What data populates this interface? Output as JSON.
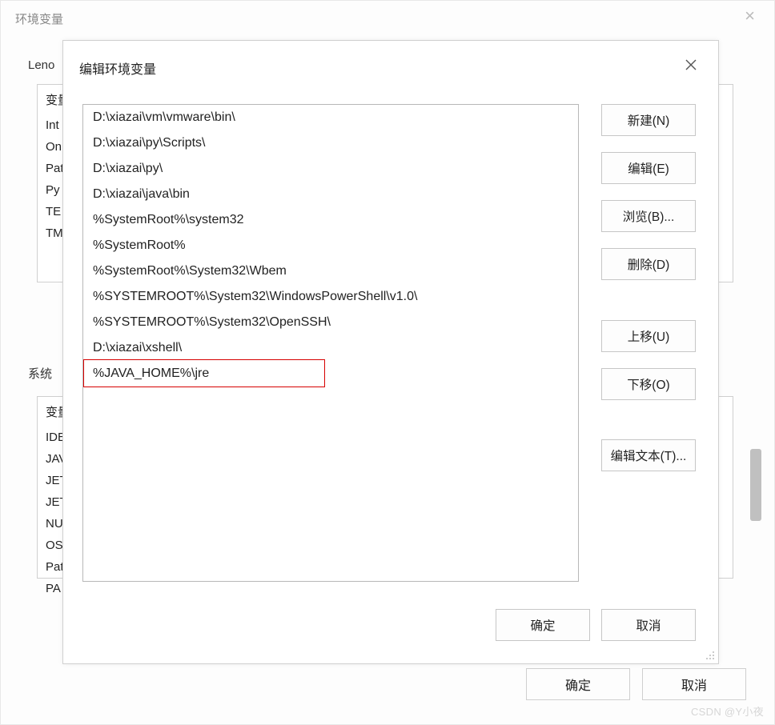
{
  "parent": {
    "title": "环境变量",
    "user_label_prefix": "Leno",
    "user_list": {
      "header": "变量",
      "rows": [
        "Int",
        "On",
        "Pat",
        "Py",
        "TE",
        "TM"
      ]
    },
    "sys_label_prefix": "系统",
    "sys_list": {
      "header": "变量",
      "rows": [
        "IDE",
        "JAV",
        "JET",
        "JET",
        "NU",
        "OS",
        "Pat",
        "PA"
      ]
    },
    "ok_label": "确定",
    "cancel_label": "取消"
  },
  "modal": {
    "title": "编辑环境变量",
    "entries": [
      "D:\\xiazai\\vm\\vmware\\bin\\",
      "D:\\xiazai\\py\\Scripts\\",
      "D:\\xiazai\\py\\",
      "D:\\xiazai\\java\\bin",
      "%SystemRoot%\\system32",
      "%SystemRoot%",
      "%SystemRoot%\\System32\\Wbem",
      "%SYSTEMROOT%\\System32\\WindowsPowerShell\\v1.0\\",
      "%SYSTEMROOT%\\System32\\OpenSSH\\",
      "D:\\xiazai\\xshell\\",
      "%JAVA_HOME%\\jre"
    ],
    "highlighted_index": 10,
    "buttons": {
      "new": "新建(N)",
      "edit": "编辑(E)",
      "browse": "浏览(B)...",
      "delete": "删除(D)",
      "up": "上移(U)",
      "down": "下移(O)",
      "edit_text": "编辑文本(T)...",
      "ok": "确定",
      "cancel": "取消"
    }
  },
  "watermark": "CSDN @Y小夜"
}
